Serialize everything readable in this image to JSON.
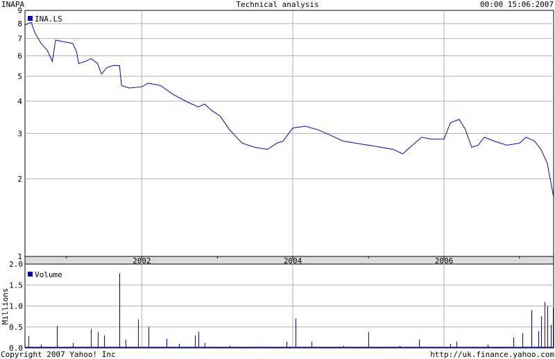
{
  "header": {
    "symbol": "INAPA",
    "title": "Technical analysis",
    "timestamp": "00:00 15:06:2007"
  },
  "footer": {
    "copyright": "Copyright 2007 Yahoo! Inc",
    "url": "http://uk.finance.yahoo.com"
  },
  "colors": {
    "series": "#0000cc",
    "grid": "#b0b0b0",
    "band": "#dcdcdc"
  },
  "chart_data": [
    {
      "type": "line",
      "legend": "INA.LS",
      "y_scale": "log",
      "ylim": [
        1,
        9
      ],
      "y_ticks": [
        1,
        2,
        3,
        4,
        5,
        6,
        7,
        8,
        9
      ],
      "xlim": [
        "2000-06-15",
        "2007-06-15"
      ],
      "x_tick_labels": [
        "2002",
        "2004",
        "2006"
      ],
      "x_ticks": [
        "2002-01-01",
        "2004-01-01",
        "2006-01-01"
      ],
      "x_minor_ticks": [
        "2001-01-01",
        "2003-01-01",
        "2005-01-01",
        "2007-01-01"
      ],
      "grid": true,
      "legend_position": "top-left",
      "series": [
        {
          "name": "INA.LS",
          "points": [
            [
              "2000-06-15",
              7.9
            ],
            [
              "2000-07-15",
              8.1
            ],
            [
              "2000-08-01",
              7.4
            ],
            [
              "2000-09-01",
              6.7
            ],
            [
              "2000-10-01",
              6.3
            ],
            [
              "2000-10-25",
              5.7
            ],
            [
              "2000-11-10",
              6.9
            ],
            [
              "2000-12-20",
              6.8
            ],
            [
              "2001-02-01",
              6.7
            ],
            [
              "2001-02-20",
              6.2
            ],
            [
              "2001-03-01",
              5.6
            ],
            [
              "2001-04-01",
              5.7
            ],
            [
              "2001-05-01",
              5.85
            ],
            [
              "2001-06-01",
              5.6
            ],
            [
              "2001-06-20",
              5.1
            ],
            [
              "2001-07-15",
              5.4
            ],
            [
              "2001-08-15",
              5.5
            ],
            [
              "2001-09-15",
              5.5
            ],
            [
              "2001-09-25",
              4.6
            ],
            [
              "2001-11-01",
              4.5
            ],
            [
              "2002-01-01",
              4.55
            ],
            [
              "2002-02-01",
              4.7
            ],
            [
              "2002-04-01",
              4.6
            ],
            [
              "2002-06-01",
              4.25
            ],
            [
              "2002-08-01",
              4.0
            ],
            [
              "2002-10-01",
              3.8
            ],
            [
              "2002-11-01",
              3.9
            ],
            [
              "2002-12-01",
              3.7
            ],
            [
              "2003-01-15",
              3.5
            ],
            [
              "2003-03-01",
              3.1
            ],
            [
              "2003-05-01",
              2.75
            ],
            [
              "2003-07-01",
              2.65
            ],
            [
              "2003-09-01",
              2.6
            ],
            [
              "2003-10-15",
              2.75
            ],
            [
              "2003-11-15",
              2.8
            ],
            [
              "2004-01-01",
              3.15
            ],
            [
              "2004-03-01",
              3.2
            ],
            [
              "2004-05-01",
              3.1
            ],
            [
              "2004-07-01",
              2.95
            ],
            [
              "2004-09-01",
              2.8
            ],
            [
              "2004-11-01",
              2.75
            ],
            [
              "2005-01-01",
              2.7
            ],
            [
              "2005-03-01",
              2.65
            ],
            [
              "2005-05-01",
              2.6
            ],
            [
              "2005-06-15",
              2.5
            ],
            [
              "2005-08-01",
              2.7
            ],
            [
              "2005-09-15",
              2.9
            ],
            [
              "2005-11-01",
              2.85
            ],
            [
              "2006-01-01",
              2.85
            ],
            [
              "2006-02-01",
              3.3
            ],
            [
              "2006-03-15",
              3.4
            ],
            [
              "2006-04-15",
              3.1
            ],
            [
              "2006-05-15",
              2.65
            ],
            [
              "2006-06-15",
              2.7
            ],
            [
              "2006-07-15",
              2.9
            ],
            [
              "2006-09-01",
              2.8
            ],
            [
              "2006-11-01",
              2.7
            ],
            [
              "2007-01-01",
              2.75
            ],
            [
              "2007-02-01",
              2.9
            ],
            [
              "2007-03-15",
              2.8
            ],
            [
              "2007-04-15",
              2.6
            ],
            [
              "2007-05-15",
              2.3
            ],
            [
              "2007-06-15",
              1.7
            ]
          ]
        }
      ]
    },
    {
      "type": "bar",
      "legend": "Volume",
      "ylabel": "Millions",
      "ylim": [
        0,
        2.0
      ],
      "y_tick_labels": [
        "0.0",
        "0.5",
        "1.0",
        "1.5",
        "2.0"
      ],
      "xlim": [
        "2000-06-15",
        "2007-06-15"
      ],
      "grid": true,
      "legend_position": "top-left",
      "series": [
        {
          "name": "Volume",
          "points": [
            [
              "2000-07-01",
              0.28
            ],
            [
              "2000-09-01",
              0.08
            ],
            [
              "2000-11-15",
              0.52
            ],
            [
              "2001-02-01",
              0.12
            ],
            [
              "2001-05-01",
              0.45
            ],
            [
              "2001-06-01",
              0.38
            ],
            [
              "2001-07-01",
              0.3
            ],
            [
              "2001-09-15",
              1.78
            ],
            [
              "2001-10-15",
              0.2
            ],
            [
              "2001-12-15",
              0.68
            ],
            [
              "2002-02-01",
              0.5
            ],
            [
              "2002-05-01",
              0.22
            ],
            [
              "2002-07-01",
              0.1
            ],
            [
              "2002-09-15",
              0.3
            ],
            [
              "2002-10-01",
              0.38
            ],
            [
              "2002-11-01",
              0.12
            ],
            [
              "2003-03-01",
              0.05
            ],
            [
              "2003-08-01",
              0.03
            ],
            [
              "2003-12-01",
              0.15
            ],
            [
              "2004-01-15",
              0.7
            ],
            [
              "2004-04-01",
              0.15
            ],
            [
              "2004-09-01",
              0.05
            ],
            [
              "2005-01-01",
              0.38
            ],
            [
              "2005-06-01",
              0.05
            ],
            [
              "2005-09-01",
              0.2
            ],
            [
              "2006-02-01",
              0.1
            ],
            [
              "2006-03-01",
              0.15
            ],
            [
              "2006-08-01",
              0.08
            ],
            [
              "2006-12-01",
              0.25
            ],
            [
              "2007-01-15",
              0.35
            ],
            [
              "2007-03-01",
              0.9
            ],
            [
              "2007-04-01",
              0.4
            ],
            [
              "2007-04-15",
              0.75
            ],
            [
              "2007-05-01",
              1.1
            ],
            [
              "2007-05-15",
              1.0
            ],
            [
              "2007-06-01",
              0.55
            ],
            [
              "2007-06-10",
              0.95
            ]
          ]
        }
      ]
    }
  ]
}
